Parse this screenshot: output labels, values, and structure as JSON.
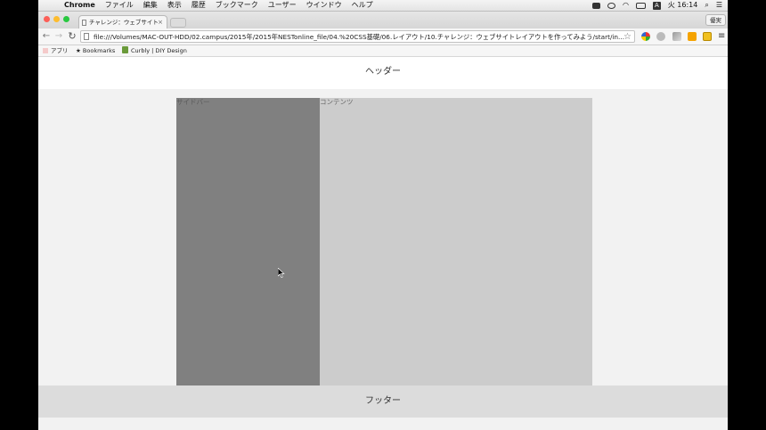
{
  "menubar": {
    "apple": "",
    "app_name": "Chrome",
    "items": [
      "ファイル",
      "編集",
      "表示",
      "履歴",
      "ブックマーク",
      "ユーザー",
      "ウインドウ",
      "ヘルプ"
    ],
    "status_icons": [
      "dropbox-icon",
      "record-icon",
      "wifi-icon",
      "battery-icon",
      "input-source-icon"
    ],
    "input_source": "A",
    "clock": "火 16:14"
  },
  "browser": {
    "tab_title": "チャレンジ：ウェブサイトレ",
    "tab_close": "×",
    "profile_button": "優実",
    "back": "←",
    "forward": "→",
    "reload": "C",
    "url": "file:///Volumes/MAC-OUT-HDD/02.campus/2015年/2015年NESTonline_file/04.%20CSS基礎/06.レイアウト/10.チャレンジ：ウェブサイトレイアウトを作ってみよう/start/in...",
    "star": "☆",
    "menu": "≡",
    "bookmarks": {
      "apps": "アプリ",
      "bookmarks": "Bookmarks",
      "curbly": "Curbly | DIY Design"
    }
  },
  "page": {
    "header": "ヘッダー",
    "sidebar": "サイドバー",
    "content": "コンテンツ",
    "footer": "フッター"
  },
  "colors": {
    "header_bg": "#ffffff",
    "sidebar_bg": "#808080",
    "content_bg": "#cccccc",
    "footer_bg": "#dcdcdc",
    "page_bg": "#f2f2f2"
  }
}
